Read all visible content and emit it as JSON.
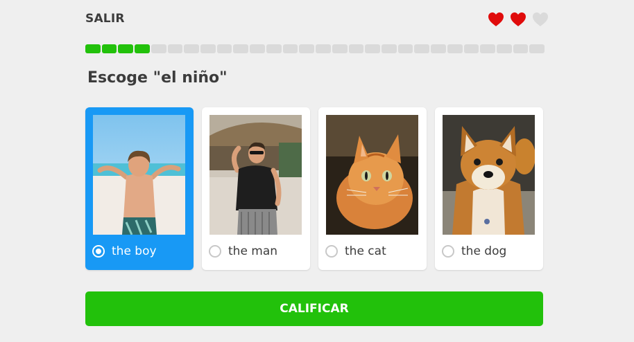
{
  "header": {
    "exit_label": "SALIR",
    "hearts": [
      {
        "icon": "heart-full-icon",
        "color": "#e00b0b"
      },
      {
        "icon": "heart-full-icon",
        "color": "#e00b0b"
      },
      {
        "icon": "heart-empty-icon",
        "color": "#dadada"
      }
    ]
  },
  "progress": {
    "completed": 4,
    "total": 28,
    "fill_color": "#22c10b",
    "track_color": "#dadada"
  },
  "prompt": "Escoge \"el niño\"",
  "options": [
    {
      "label": "the boy",
      "image": "boy-at-beach-photo",
      "selected": true
    },
    {
      "label": "the man",
      "image": "man-waving-photo",
      "selected": false
    },
    {
      "label": "the cat",
      "image": "orange-cat-photo",
      "selected": false
    },
    {
      "label": "the dog",
      "image": "shiba-dog-photo",
      "selected": false
    }
  ],
  "check_button": {
    "label": "CALIFICAR",
    "color": "#22c10b"
  },
  "colors": {
    "selected_card": "#1899f5",
    "text": "#3c3c3c",
    "background": "#efefef"
  }
}
